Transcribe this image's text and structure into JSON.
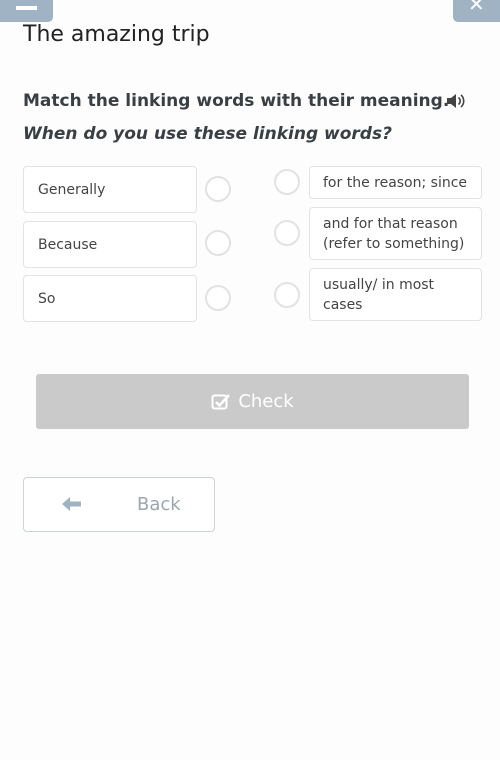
{
  "window": {
    "minimize_icon": "minus-icon",
    "close_icon": "close-icon"
  },
  "header": {
    "title": "The amazing trip"
  },
  "exercise": {
    "instruction": "Match the linking words with their meaning.",
    "audio_icon": "speaker-icon",
    "question": "When do you use these linking words?",
    "left_items": [
      {
        "label": "Generally"
      },
      {
        "label": "Because"
      },
      {
        "label": "So"
      }
    ],
    "right_items": [
      {
        "label": "for the reason; since"
      },
      {
        "label": "and for that reason (refer to something)"
      },
      {
        "label": "usually/ in most cases"
      }
    ]
  },
  "actions": {
    "check_label": "Check",
    "check_icon": "checkbox-check-icon",
    "back_label": "Back",
    "back_icon": "arrow-left-icon"
  },
  "colors": {
    "corner_button": "#9fb3c4",
    "check_button_disabled": "#cacaca",
    "back_text": "#9aa7af"
  }
}
